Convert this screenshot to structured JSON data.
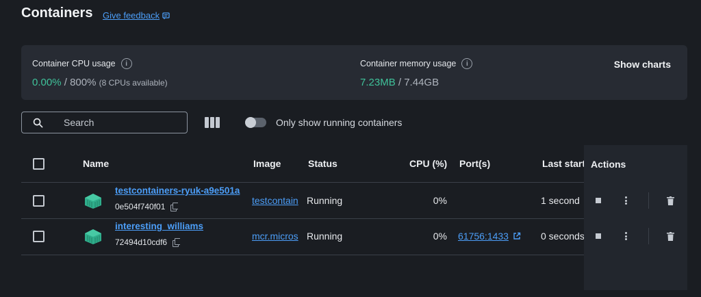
{
  "header": {
    "title": "Containers",
    "feedback_label": "Give feedback"
  },
  "stats": {
    "cpu_label": "Container CPU usage",
    "cpu_used": "0.00%",
    "cpu_sep": " / ",
    "cpu_total": "800%",
    "cpu_note": "(8 CPUs available)",
    "mem_label": "Container memory usage",
    "mem_used": "7.23MB",
    "mem_sep": " / ",
    "mem_total": "7.44GB",
    "show_charts_label": "Show charts"
  },
  "toolbar": {
    "search_placeholder": "Search",
    "toggle_label": "Only show running containers",
    "toggle_on": false
  },
  "table": {
    "columns": [
      "Name",
      "Image",
      "Status",
      "CPU (%)",
      "Port(s)",
      "Last start",
      "Actions"
    ],
    "rows": [
      {
        "name": "testcontainers-ryuk-a9e501a",
        "id": "0e504f740f01",
        "image": "testcontain",
        "status": "Running",
        "cpu": "0%",
        "ports": "",
        "last_started": "1 second"
      },
      {
        "name": "interesting_williams",
        "id": "72494d10cdf6",
        "image": "mcr.micros",
        "status": "Running",
        "cpu": "0%",
        "ports": "61756:1433",
        "last_started": "0 seconds"
      }
    ]
  },
  "colors": {
    "accent": "#4c9ef8",
    "green": "#3fc29a",
    "background": "#1a1d22",
    "card": "#272b33"
  }
}
